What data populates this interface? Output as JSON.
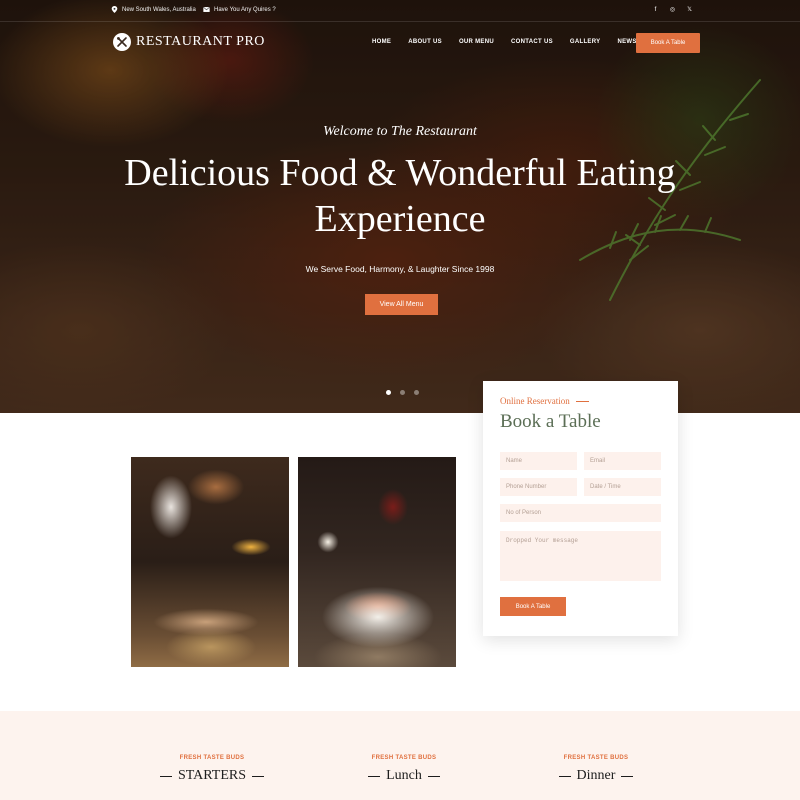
{
  "topbar": {
    "location": "New South Wales, Australia",
    "inquiry": "Have You Any Quires ?",
    "socials": [
      {
        "icon": "facebook-icon",
        "glyph": "f"
      },
      {
        "icon": "instagram-icon",
        "glyph": "◎"
      },
      {
        "icon": "x-icon",
        "glyph": "𝕏"
      }
    ]
  },
  "nav": {
    "logo": "RESTAURANT PRO",
    "items": [
      "HOME",
      "ABOUT US",
      "OUR MENU",
      "CONTACT US",
      "GALLERY",
      "NEWS"
    ],
    "cta": "Book A Table"
  },
  "hero": {
    "subtitle": "Welcome to The Restaurant",
    "title": "Delicious Food & Wonderful Eating Experience",
    "description": "We Serve Food, Harmony, & Laughter Since 1998",
    "button": "View All Menu",
    "slides": 3,
    "active_slide": 1
  },
  "reservation": {
    "kicker": "Online Reservation",
    "title": "Book a Table",
    "fields": {
      "name": "Name",
      "email": "Email",
      "phone": "Phone Number",
      "date": "Date / Time",
      "persons": "No of Person",
      "message": "Dropped Your message"
    },
    "submit": "Book A Table"
  },
  "menus": [
    {
      "kicker": "FRESH TASTE BUDS",
      "title": "STARTERS"
    },
    {
      "kicker": "FRESH TASTE BUDS",
      "title": "Lunch"
    },
    {
      "kicker": "FRESH TASTE BUDS",
      "title": "Dinner"
    }
  ],
  "colors": {
    "accent": "#e0703f",
    "title_green": "#5b6e55",
    "band_bg": "#fdf3ee"
  }
}
